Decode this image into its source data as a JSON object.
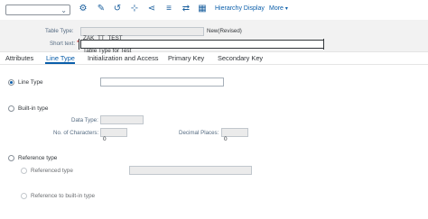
{
  "toolbar": {
    "dropdown_value": "",
    "icons": [
      "settings-check-icon",
      "display-change-icon",
      "activate-icon",
      "where-used-icon",
      "hierarchy-tree-icon",
      "object-list-icon",
      "transport-icon"
    ],
    "hierarchy_display_label": "Hierarchy Display",
    "more_label": "More"
  },
  "header": {
    "table_type_label": "Table Type:",
    "table_type_value": "ZAK_TT_TEST",
    "status": "New(Revised)",
    "short_text_label": "Short text:",
    "short_text_value": "Table Type for Test"
  },
  "tabs": [
    "Attributes",
    "Line Type",
    "Initialization and Access",
    "Primary Key",
    "Secondary Key"
  ],
  "active_tab": "Line Type",
  "line_type": {
    "line_type_label": "Line Type",
    "line_type_value": "",
    "builtin_label": "Built-in type",
    "data_type_label": "Data Type:",
    "data_type_value": "",
    "num_chars_label": "No. of Characters:",
    "num_chars_value": "0",
    "decimal_label": "Decimal Places:",
    "decimal_value": "0",
    "reference_label": "Reference type",
    "referenced_type_label": "Referenced type",
    "referenced_type_value": "",
    "ref_builtin_label": "Reference to built-in type"
  }
}
